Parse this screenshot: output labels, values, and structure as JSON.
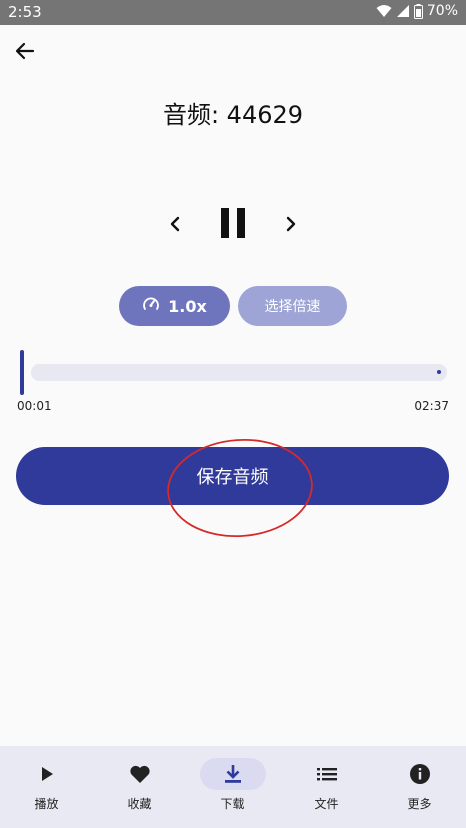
{
  "status": {
    "time": "2:53",
    "battery": "70%"
  },
  "header": {
    "title": "音频: 44629"
  },
  "controls": {
    "prev_icon": "chevron-left-icon",
    "pause_icon": "pause-icon",
    "next_icon": "chevron-right-icon"
  },
  "speed": {
    "current": "1.0x",
    "select_label": "选择倍速"
  },
  "progress": {
    "current": "00:01",
    "total": "02:37",
    "fraction": 0.006
  },
  "save": {
    "label": "保存音频"
  },
  "nav": {
    "items": [
      {
        "label": "播放",
        "icon": "play-icon"
      },
      {
        "label": "收藏",
        "icon": "heart-icon"
      },
      {
        "label": "下载",
        "icon": "download-icon",
        "active": true
      },
      {
        "label": "文件",
        "icon": "list-icon"
      },
      {
        "label": "更多",
        "icon": "info-icon"
      }
    ]
  },
  "colors": {
    "primary": "#2f3a9a",
    "speed_button": "#6f75bd",
    "select_button": "#9ea4d6",
    "annotation": "#d42a2a"
  }
}
